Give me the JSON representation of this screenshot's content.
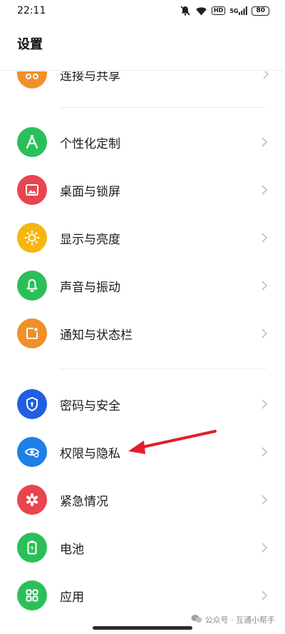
{
  "status": {
    "time": "22:11",
    "hd": "HD",
    "network": "5G",
    "battery": "80"
  },
  "header": {
    "title": "设置"
  },
  "partial_item": {
    "label": "连接与共享",
    "color": "#f0902a"
  },
  "items": [
    {
      "label": "个性化定制",
      "color": "#2bbf5a",
      "icon": "personalize-icon"
    },
    {
      "label": "桌面与锁屏",
      "color": "#e8454f",
      "icon": "wallpaper-icon"
    },
    {
      "label": "显示与亮度",
      "color": "#f5b70e",
      "icon": "brightness-icon"
    },
    {
      "label": "声音与振动",
      "color": "#2bbf5a",
      "icon": "bell-icon"
    },
    {
      "label": "通知与状态栏",
      "color": "#f0902a",
      "icon": "notification-icon"
    },
    {
      "label": "密码与安全",
      "color": "#1f5fe0",
      "icon": "shield-lock-icon"
    },
    {
      "label": "权限与隐私",
      "color": "#1e7fe6",
      "icon": "privacy-eye-icon"
    },
    {
      "label": "紧急情况",
      "color": "#e8454f",
      "icon": "emergency-icon"
    },
    {
      "label": "电池",
      "color": "#2bbf5a",
      "icon": "battery-icon"
    },
    {
      "label": "应用",
      "color": "#2bbf5a",
      "icon": "apps-grid-icon"
    }
  ],
  "annotation": {
    "color": "#e0202a"
  },
  "watermark": {
    "text": "公众号 · 互通小帮手"
  }
}
